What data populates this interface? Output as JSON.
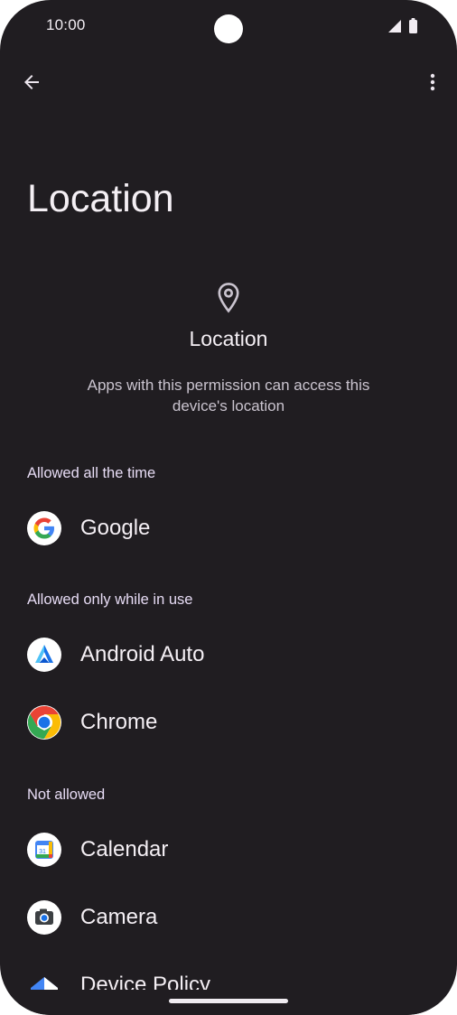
{
  "status_bar": {
    "time": "10:00"
  },
  "toolbar": {
    "back_icon": "arrow-back-icon",
    "more_icon": "more-vert-icon"
  },
  "page": {
    "title": "Location",
    "permission_icon": "location-pin-icon",
    "permission_title": "Location",
    "permission_description": "Apps with this permission can access this device's location"
  },
  "sections": [
    {
      "header": "Allowed all the time",
      "apps": [
        {
          "label": "Google",
          "icon": "google-icon"
        }
      ]
    },
    {
      "header": "Allowed only while in use",
      "apps": [
        {
          "label": "Android Auto",
          "icon": "android-auto-icon"
        },
        {
          "label": "Chrome",
          "icon": "chrome-icon"
        }
      ]
    },
    {
      "header": "Not allowed",
      "apps": [
        {
          "label": "Calendar",
          "icon": "calendar-icon",
          "icon_text": "31"
        },
        {
          "label": "Camera",
          "icon": "camera-icon"
        },
        {
          "label": "Device Policy",
          "icon": "device-policy-icon"
        }
      ]
    }
  ],
  "colors": {
    "background": "#201d21",
    "text_primary": "#f4eff4",
    "section_header": "#e7dcf5",
    "google_blue": "#4285F4",
    "google_red": "#EA4335",
    "google_yellow": "#FBBC05",
    "google_green": "#34A853"
  }
}
